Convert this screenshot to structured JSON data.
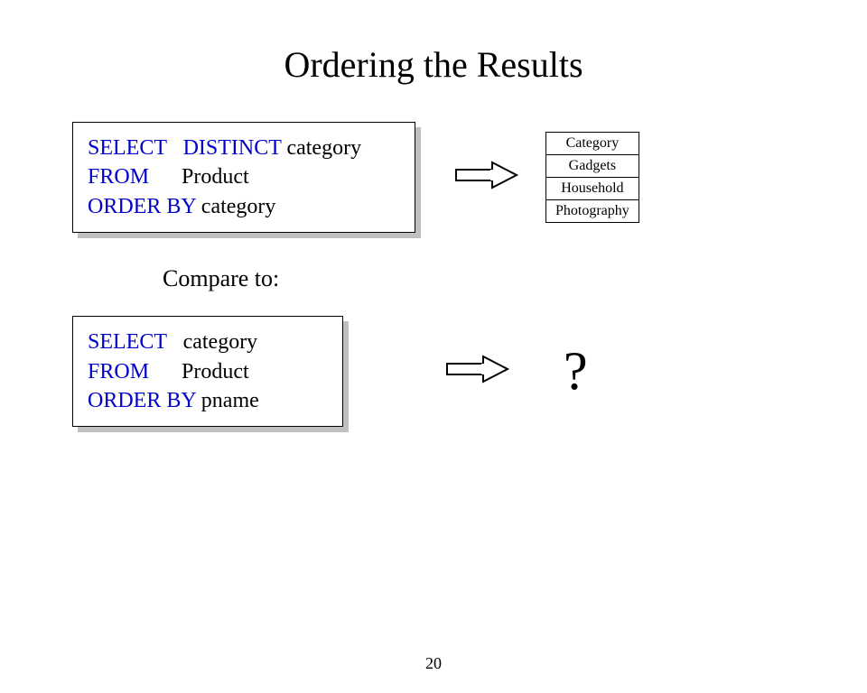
{
  "title": "Ordering the Results",
  "query1": {
    "kw_select": "SELECT   DISTINCT",
    "after_select": " category",
    "kw_from": "FROM",
    "after_from": "      Product",
    "kw_orderby": "ORDER BY",
    "after_orderby": " category"
  },
  "result1": {
    "header": "Category",
    "rows": [
      "Gadgets",
      "Household",
      "Photography"
    ]
  },
  "compare_label": "Compare to:",
  "query2": {
    "kw_select": "SELECT",
    "after_select": "   category",
    "kw_from": "FROM",
    "after_from": "      Product",
    "kw_orderby": "ORDER BY",
    "after_orderby": " pname"
  },
  "question_mark": "?",
  "page_number": "20"
}
